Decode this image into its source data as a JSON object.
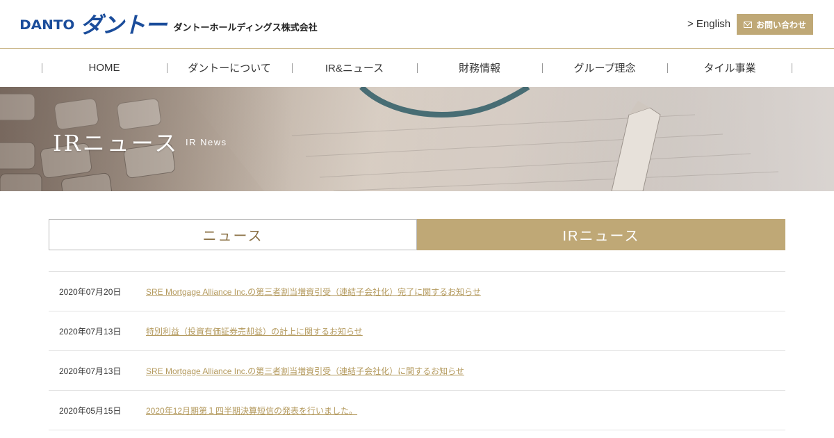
{
  "header": {
    "logo_en": "DANTO",
    "logo_kana": "ダントー",
    "company_name": "ダントーホールディングス株式会社",
    "english_link": "> English",
    "contact_label": "お問い合わせ"
  },
  "nav": {
    "items": [
      {
        "label": "HOME"
      },
      {
        "label": "ダントーについて"
      },
      {
        "label": "IR&ニュース"
      },
      {
        "label": "財務情報"
      },
      {
        "label": "グループ理念"
      },
      {
        "label": "タイル事業"
      }
    ]
  },
  "hero": {
    "title": "IRニュース",
    "subtitle": "IR News"
  },
  "tabs": {
    "news": "ニュース",
    "ir_news": "IRニュース"
  },
  "news": [
    {
      "date": "2020年07月20日",
      "title": "SRE Mortgage Alliance Inc.の第三者割当増資引受（連結子会社化）完了に関するお知らせ"
    },
    {
      "date": "2020年07月13日",
      "title": "特別利益（投資有価証券売却益）の計上に関するお知らせ"
    },
    {
      "date": "2020年07月13日",
      "title": "SRE Mortgage Alliance Inc.の第三者割当増資引受（連結子会社化）に関するお知らせ"
    },
    {
      "date": "2020年05月15日",
      "title": "2020年12月期第１四半期決算短信の発表を行いました。"
    }
  ],
  "colors": {
    "brand_blue": "#1b4d9b",
    "accent_gold": "#bfa876",
    "link_gold": "#b49a5e"
  },
  "icons": {
    "contact": "mail-icon"
  }
}
